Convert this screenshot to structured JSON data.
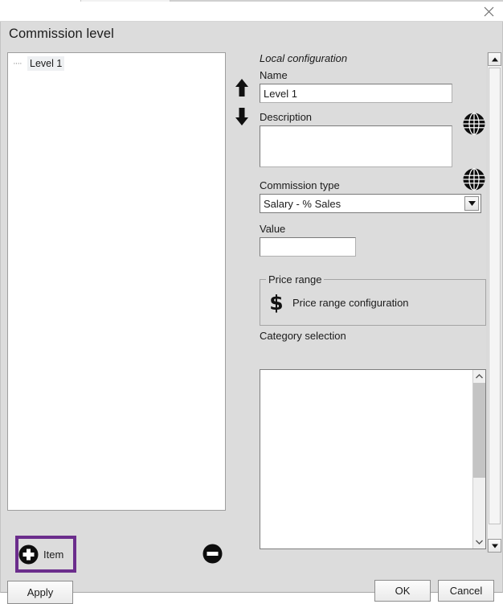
{
  "window": {
    "close_icon": "close-icon"
  },
  "dialog": {
    "title": "Commission level"
  },
  "tree": {
    "connector": "····",
    "items": [
      {
        "label": "Level 1",
        "selected": true
      }
    ]
  },
  "reorder": {
    "move_up_icon": "arrow-up-icon",
    "move_down_icon": "arrow-down-icon"
  },
  "form": {
    "section_title": "Local configuration",
    "name": {
      "label": "Name",
      "value": "Level 1",
      "placeholder": "",
      "translate_icon": "globe-icon"
    },
    "description": {
      "label": "Description",
      "value": "",
      "placeholder": "",
      "translate_icon": "globe-icon"
    },
    "commission_type": {
      "label": "Commission type",
      "selected": "Salary - % Sales",
      "options": [
        "Salary - % Sales"
      ],
      "arrow_icon": "chevron-down-icon"
    },
    "value": {
      "label": "Value",
      "value": "",
      "placeholder": ""
    },
    "price_range": {
      "legend": "Price range",
      "icon": "dollar-icon",
      "link_label": "Price range configuration"
    },
    "category_selection": {
      "label": "Category selection",
      "items": [],
      "scroll_up_icon": "chevron-up-icon",
      "scroll_down_icon": "chevron-down-icon"
    }
  },
  "scrollbar": {
    "up_icon": "triangle-up-icon",
    "down_icon": "triangle-down-icon"
  },
  "actions": {
    "add_item": "Item",
    "add_item_icon": "plus-circle-icon",
    "remove_item_icon": "minus-circle-icon",
    "apply": "Apply",
    "ok": "OK",
    "cancel": "Cancel"
  },
  "colors": {
    "dialog_background": "#dcdcdc",
    "highlight_purple": "#6b2d8c",
    "field_background": "#ffffff",
    "text": "#1b1b1b"
  }
}
